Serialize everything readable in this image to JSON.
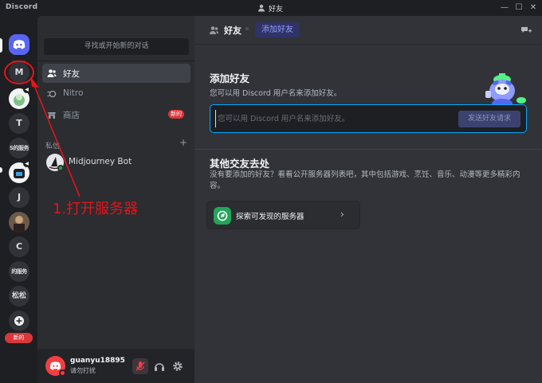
{
  "app": {
    "name": "Discord",
    "header_title": "好友"
  },
  "titlebar": {
    "minimize": "—",
    "maximize": "☐",
    "close": "✕"
  },
  "servers": [
    {
      "label": "M"
    },
    {
      "label": "T"
    },
    {
      "label": "S的服务"
    },
    {
      "label": "J"
    },
    {
      "label": "C"
    },
    {
      "label": "的服务"
    },
    {
      "label": "松松"
    }
  ],
  "server_rail": {
    "new_badge": "新的"
  },
  "sidebar": {
    "find_conversation": "寻找或开始新的对话",
    "nav": [
      {
        "label": "好友"
      },
      {
        "label": "Nitro"
      },
      {
        "label": "商店",
        "badge": "新的"
      }
    ],
    "dm_header": "私信",
    "dm_add": "+",
    "dms": [
      {
        "name": "Midjourney Bot"
      }
    ]
  },
  "user": {
    "name": "guanyu18895",
    "status_text": "请勿打扰"
  },
  "main": {
    "tab_title": "好友",
    "tab_add": "添加好友",
    "add_friend": {
      "title": "添加好友",
      "description": "您可以用 Discord 用户名来添加好友。",
      "placeholder": "您可以用 Discord 用户名来添加好友。",
      "button": "发送好友请求"
    },
    "other": {
      "title": "其他交友去处",
      "description": "没有要添加的好友？看看公开服务器列表吧，其中包括游戏、烹饪、音乐、动漫等更多精彩内容。",
      "explore_label": "探索可发现的服务器",
      "explore_chevron": "›"
    }
  },
  "annotation": {
    "text": "1.打开服务器"
  },
  "colors": {
    "blurple": "#5865f2",
    "annotation_red": "#e3141b",
    "online": "#23a55a",
    "dnd": "#f23f43"
  }
}
